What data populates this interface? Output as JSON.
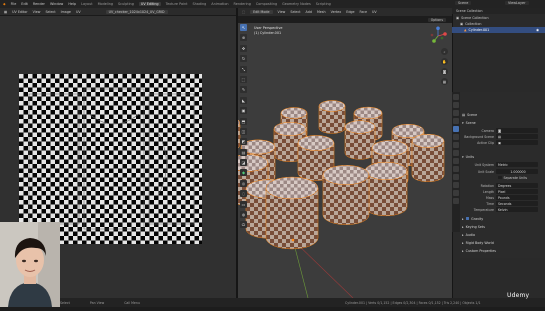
{
  "topbar": {
    "menus": [
      "File",
      "Edit",
      "Render",
      "Window",
      "Help"
    ],
    "workspaces": [
      "Layout",
      "Modeling",
      "Sculpting",
      "UV Editing",
      "Texture Paint",
      "Shading",
      "Animation",
      "Rendering",
      "Compositing",
      "Geometry Nodes",
      "Scripting"
    ],
    "active_workspace": "UV Editing",
    "scene": "Scene",
    "view_layer": "ViewLayer"
  },
  "uv_editor": {
    "header_items": [
      "UV Editor",
      "View",
      "Select",
      "Image",
      "UV"
    ],
    "image_name": "UV_checker_1024x1024_UV_GRID"
  },
  "viewport": {
    "mode": "Edit Mode",
    "header_items": [
      "View",
      "Select",
      "Add",
      "Mesh",
      "Vertex",
      "Edge",
      "Face",
      "UV"
    ],
    "options_label": "Options",
    "info_line1": "User Perspective",
    "info_line2": "(1) Cylinder.001"
  },
  "outliner": {
    "title": "Scene Collection",
    "rows": [
      {
        "label": "Scene Collection",
        "selected": false
      },
      {
        "label": "Collection",
        "selected": false
      },
      {
        "label": "Cylinder.001",
        "selected": true
      }
    ]
  },
  "properties": {
    "scene_label": "Scene",
    "section_scene": "Scene",
    "camera_label": "Camera",
    "background_scene_label": "Background Scene",
    "active_clip_label": "Active Clip",
    "section_units": "Units",
    "unit_system_label": "Unit System",
    "unit_system_value": "Metric",
    "unit_scale_label": "Unit Scale",
    "unit_scale_value": "1.000000",
    "separate_units_label": "Separate Units",
    "rotation_label": "Rotation",
    "rotation_value": "Degrees",
    "length_label": "Length",
    "length_value": "Pixel",
    "mass_label": "Mass",
    "mass_value": "Pounds",
    "time_label": "Time",
    "time_value": "Seconds",
    "temperature_label": "Temperature",
    "temperature_value": "Kelvin",
    "gravity_label": "Gravity",
    "keying_sets_label": "Keying Sets",
    "audio_label": "Audio",
    "rigid_body_label": "Rigid Body World",
    "custom_props_label": "Custom Properties"
  },
  "statusbar": {
    "select_hint": "Select",
    "pan_hint": "Pan View",
    "context_hint": "Call Menu",
    "stats": "Cylinder.001 | Verts 0/1,152 | Edges 0/2,304 | Faces 0/1,152 | Tris 2,240 | Objects 1/1"
  },
  "watermark": "Udemy",
  "accent_color": "#4772b3",
  "selection_color": "#ff8c1a"
}
